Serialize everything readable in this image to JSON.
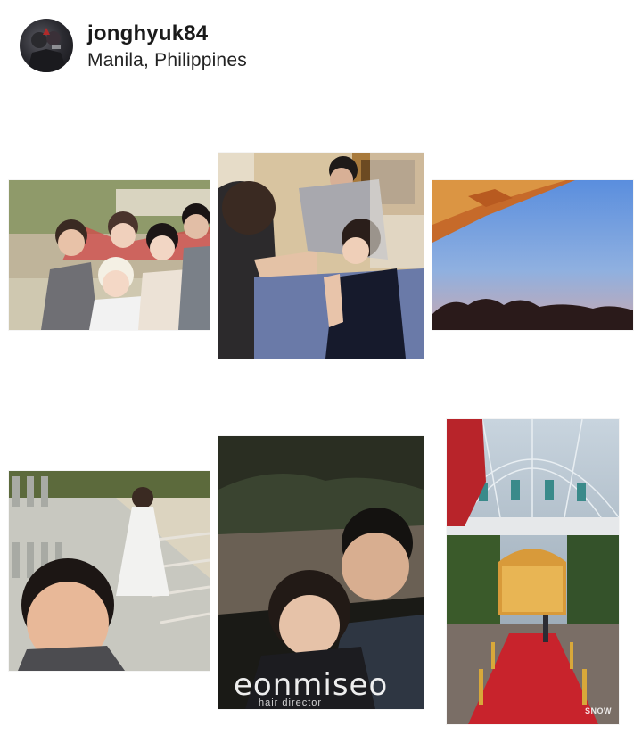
{
  "post": {
    "username": "jonghyuk84",
    "location": "Manila, Philippines"
  },
  "photos": [
    {
      "name": "group-selfie-photo"
    },
    {
      "name": "makeup-session-photo"
    },
    {
      "name": "sunset-sky-photo"
    },
    {
      "name": "staircase-selfie-photo"
    },
    {
      "name": "night-couple-selfie-photo"
    },
    {
      "name": "glass-dome-hall-photo"
    }
  ],
  "watermarks": {
    "main": "eonmiseo",
    "sub": "hair director",
    "app": "SNOW"
  },
  "colors": {
    "background": "#ffffff",
    "text": "#1a1a1a",
    "carpet": "#c8232c",
    "sky": "#6f9bd8"
  }
}
